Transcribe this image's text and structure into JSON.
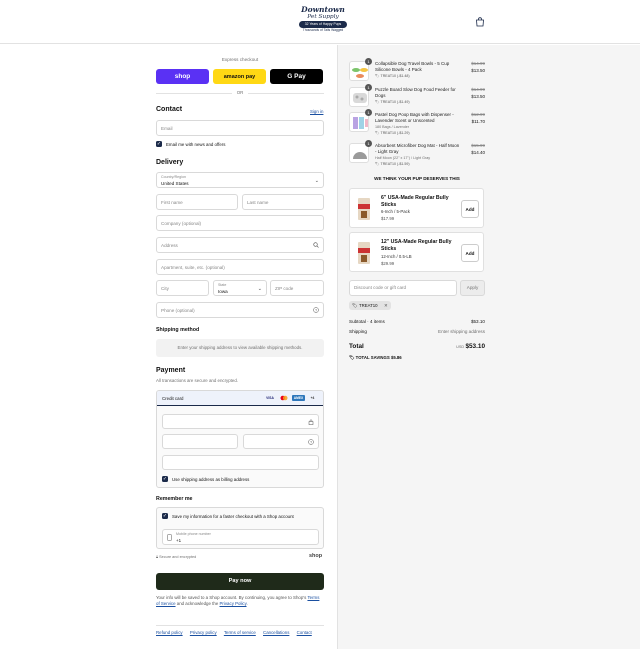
{
  "header": {
    "logo": {
      "line1": "Downtown",
      "line2": "Pet Supply",
      "pill": "32 Years of Happy Pups",
      "tagline": "Thousands of Tails Wagged"
    },
    "cart_icon": "shopping-bag-icon"
  },
  "express": {
    "title": "Express checkout",
    "shop_label": "shop",
    "amazon_label": "amazon pay",
    "gpay_label": "G Pay",
    "or_label": "OR"
  },
  "contact": {
    "heading": "Contact",
    "sign_in": "Sign in",
    "email_placeholder": "Email",
    "news_label": "Email me with news and offers"
  },
  "delivery": {
    "heading": "Delivery",
    "country_label": "Country/Region",
    "country_value": "United States",
    "first_name": "First name",
    "last_name": "Last name",
    "company": "Company (optional)",
    "address": "Address",
    "apartment": "Apartment, suite, etc. (optional)",
    "city": "City",
    "state_label": "State",
    "state_value": "Iowa",
    "zip": "ZIP code",
    "phone": "Phone (optional)"
  },
  "shipping": {
    "heading": "Shipping method",
    "note": "Enter your shipping address to view available shipping methods."
  },
  "payment": {
    "heading": "Payment",
    "subtitle": "All transactions are secure and encrypted.",
    "method_label": "Credit card",
    "card_brands": [
      "VISA",
      "MC",
      "AMEX",
      "+4"
    ],
    "billing_label": "Use shipping address as billing address"
  },
  "remember": {
    "heading": "Remember me",
    "save_label": "Save my information for a faster checkout with a Shop account",
    "phone_label": "Mobile phone number",
    "phone_value": "+1",
    "secure_label": "Secure and encrypted",
    "shop_brand": "shop"
  },
  "pay_now": "Pay now",
  "legal": {
    "text1": "Your info will be saved to a Shop account. By continuing, you agree to Shop's",
    "terms": "Terms of Service",
    "text2": "and acknowledge the",
    "privacy": "Privacy Policy",
    "period": "."
  },
  "footer_links": [
    "Refund policy",
    "Privacy policy",
    "Terms of service",
    "Cancellations",
    "Contact"
  ],
  "items": [
    {
      "name": "Collapsible Dog Travel Bowls - 5 Cup Silicone Bowls - 4 Pack",
      "variant": "",
      "qty": "1",
      "tag": "TREAT10 (-$1.48)",
      "old_price": "$14.99",
      "price": "$13.50"
    },
    {
      "name": "Puzzle Board Slow Dog Food Feeder for Dogs",
      "variant": "",
      "qty": "1",
      "tag": "TREAT10 (-$1.49)",
      "old_price": "$14.99",
      "price": "$13.50"
    },
    {
      "name": "Pastel Dog Poop Bags with Dispenser - Lavender Scent or Unscented",
      "variant": "180 Bags / Lavender",
      "qty": "1",
      "tag": "TREAT10 (-$1.29)",
      "old_price": "$12.99",
      "price": "$11.70"
    },
    {
      "name": "Absorbent Microfiber Dog Mat - Half Moon - Light Gray",
      "variant": "Half Moon (22\" x 17\") / Light Gray",
      "qty": "1",
      "tag": "TREAT10 (-$1.59)",
      "old_price": "$15.99",
      "price": "$14.40"
    }
  ],
  "upsell": {
    "heading": "WE THINK YOUR PUP DESERVES THIS",
    "products": [
      {
        "title": "6\" USA-Made Regular Bully Sticks",
        "variant": "6-Inch / 5-Pack",
        "price": "$17.99",
        "add": "Add"
      },
      {
        "title": "12\" USA-Made Regular Bully Sticks",
        "variant": "12-Inch / 0.5-LB",
        "price": "$29.99",
        "add": "Add"
      }
    ]
  },
  "discount": {
    "placeholder": "Discount code or gift card",
    "apply": "Apply",
    "applied_code": "TREAT10"
  },
  "totals": {
    "subtotal_label": "Subtotal · 4 items",
    "subtotal": "$53.10",
    "shipping_label": "Shipping",
    "shipping_value": "Enter shipping address",
    "total_label": "Total",
    "currency": "USD",
    "total": "$53.10",
    "savings_label": "TOTAL SAVINGS",
    "savings": "$5.86"
  }
}
